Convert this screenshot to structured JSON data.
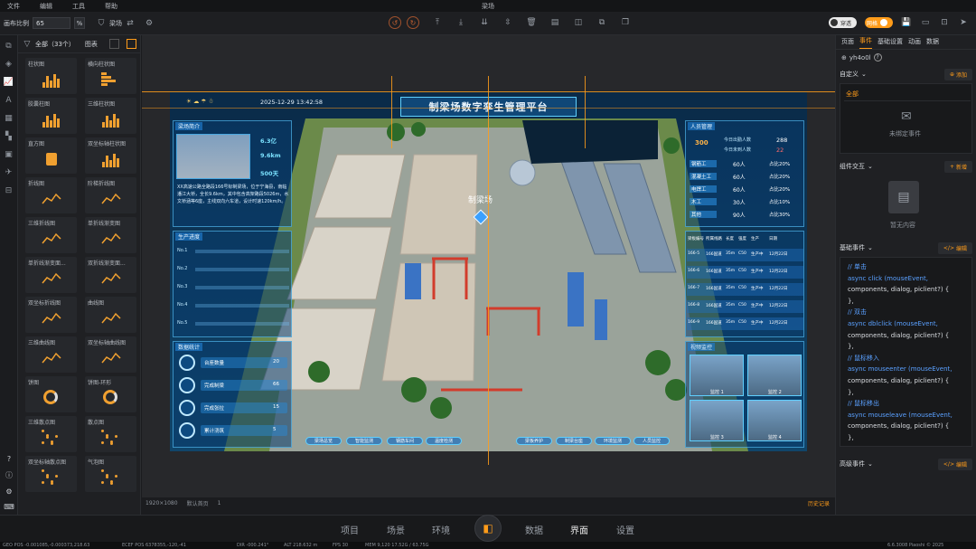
{
  "menu": {
    "items": [
      "文件",
      "编辑",
      "工具",
      "帮助"
    ],
    "title": "梁场"
  },
  "toolbar": {
    "zoom_label": "画布比例",
    "zoom_value": "65",
    "zoom_unit": "%",
    "scene_label": "梁场",
    "toggle_a": "穿透",
    "toggle_b": "网格"
  },
  "components": {
    "filter_label": "全部（33个）",
    "view_label": "图表",
    "items": [
      "柱状图",
      "横向柱状图",
      "胶囊柱图",
      "三维柱状图",
      "直方图",
      "双坐标轴柱状图",
      "折线图",
      "阶梯折线图",
      "三维折线图",
      "单折线渐变图",
      "单折线渐变面...",
      "双折线渐变面...",
      "双坐标折线图",
      "曲线图",
      "三维曲线图",
      "双坐标轴曲线图",
      "饼图",
      "饼图-环形",
      "三维散点图",
      "散点图",
      "双坐标轴散点图",
      "气泡图"
    ]
  },
  "dashboard": {
    "date": "2025-12-29 13:42:58",
    "title": "制梁场数字孪生管理平台",
    "overview_title": "梁场简介",
    "kpis": [
      "6.3亿",
      "9.6km",
      "500天"
    ],
    "intro": "XX高速公路全路段166号标制梁场，位于宁海县，南临潘江大桥，全长9.6km，其中包含高架路段5026m，水文桥涵等6座，主线双向六车道，设计时速120km/h。",
    "production_title": "生产进度",
    "prod_rows": [
      "No.1",
      "No.2",
      "No.3",
      "No.4",
      "No.5"
    ],
    "stats_title": "数据统计",
    "stats": [
      {
        "label": "台座数量",
        "value": "20"
      },
      {
        "label": "完成制梁",
        "value": "66"
      },
      {
        "label": "完成张拉",
        "value": "15"
      },
      {
        "label": "累计浇筑",
        "value": "5"
      }
    ],
    "personnel_title": "人员管理",
    "total_people": "300",
    "people_a": {
      "label": "今日出勤人数",
      "value": "288"
    },
    "people_b": {
      "label": "今日未到人数",
      "value": "22"
    },
    "roles": [
      {
        "name": "钢筋工",
        "count": "60人",
        "ratio": "占比20%"
      },
      {
        "name": "混凝土工",
        "count": "60人",
        "ratio": "占比20%"
      },
      {
        "name": "电焊工",
        "count": "60人",
        "ratio": "占比20%"
      },
      {
        "name": "木工",
        "count": "30人",
        "ratio": "占比10%"
      },
      {
        "name": "其他",
        "count": "90人",
        "ratio": "占比30%"
      }
    ],
    "table_headers": [
      "梁板编号",
      "所属线路",
      "长度",
      "强度",
      "生产",
      "日期"
    ],
    "table_rows": [
      [
        "166-5",
        "166国道",
        "35m",
        "C50",
        "生产中",
        "12月22日"
      ],
      [
        "166-6",
        "166国道",
        "35m",
        "C50",
        "生产中",
        "12月22日"
      ],
      [
        "166-7",
        "166国道",
        "35m",
        "C50",
        "生产中",
        "12月22日"
      ],
      [
        "166-8",
        "166国道",
        "35m",
        "C50",
        "生产中",
        "12月22日"
      ],
      [
        "166-9",
        "166国道",
        "35m",
        "C50",
        "生产中",
        "12月22日"
      ]
    ],
    "video_title": "视频监控",
    "cams": [
      "监控 1",
      "监控 2",
      "监控 3",
      "监控 4"
    ],
    "map_label": "制梁场",
    "nav": [
      "梁场总览",
      "智能监测",
      "钢筋车间",
      "温度检测",
      "梁板养护",
      "制梁台座",
      "环境监测",
      "人员监控"
    ]
  },
  "canvas_status": {
    "size": "1920×1080",
    "page": "默认首页",
    "layers": "1",
    "history": "历史记录"
  },
  "right": {
    "tabs": [
      "页面",
      "事件",
      "基础设置",
      "动画",
      "数据"
    ],
    "active_tab": "事件",
    "id": "yh4o0l",
    "custom_label": "自定义",
    "add_label": "添加",
    "all_label": "全部",
    "unbound": "未绑定事件",
    "interact_label": "组件交互",
    "new_label": "新增",
    "empty": "暂无内容",
    "base_label": "基础事件",
    "edit_label": "编辑",
    "code": [
      {
        "t": "c",
        "s": "// 单击"
      },
      {
        "t": "k",
        "s": "async click (mouseEvent,"
      },
      {
        "t": "t",
        "s": "components, dialog, piclient?) {"
      },
      {
        "t": "t",
        "s": "},"
      },
      {
        "t": "c",
        "s": "// 双击"
      },
      {
        "t": "k",
        "s": "async dblclick (mouseEvent,"
      },
      {
        "t": "t",
        "s": "components, dialog, piclient?) {"
      },
      {
        "t": "t",
        "s": "},"
      },
      {
        "t": "c",
        "s": "// 鼠标移入"
      },
      {
        "t": "k",
        "s": "async mouseenter (mouseEvent,"
      },
      {
        "t": "t",
        "s": "components, dialog, piclient?) {"
      },
      {
        "t": "t",
        "s": "},"
      },
      {
        "t": "c",
        "s": "// 鼠标移出"
      },
      {
        "t": "k",
        "s": "async mouseleave (mouseEvent,"
      },
      {
        "t": "t",
        "s": "components, dialog, piclient?) {"
      },
      {
        "t": "t",
        "s": "},"
      }
    ],
    "advanced_label": "高级事件",
    "edit2_label": "编辑"
  },
  "bottom_nav": {
    "items": [
      "项目",
      "场景",
      "环境",
      "数据",
      "界面",
      "设置"
    ],
    "active": "界面"
  },
  "geo": {
    "geo_pos": "GEO POS  -0.001085,-0.000373,218.63",
    "ecef": "ECEF POS  6378355,-120,-41",
    "dir": "DIR  -000.241°",
    "alt": "ALT  218.632 m",
    "fps": "FPS  30",
    "mem": "MEM  9,120  17.52G / 63.75G",
    "ver": "6.6.3008  Piaoshi © 2025"
  },
  "colors": {
    "accent": "#ff9c1a",
    "panel": "#1f2023",
    "cyan": "#5fd0ff"
  }
}
